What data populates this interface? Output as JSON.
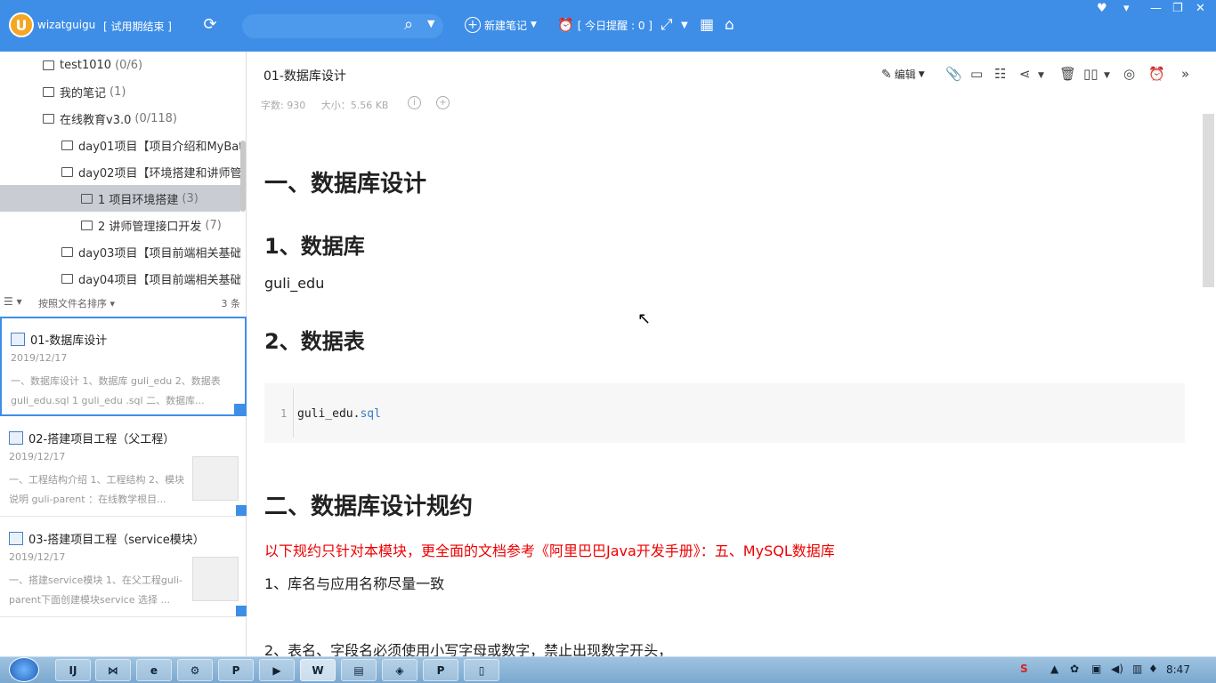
{
  "app": {
    "username": "wizatguigu",
    "trial": "[ 试用期结束 ]",
    "new_note": "新建笔记",
    "reminder": "[ 今日提醒 : 0 ]",
    "accent": "#3e8ee8"
  },
  "tree": [
    {
      "label": "test1010",
      "count": "(0/6)",
      "indent": 1
    },
    {
      "label": "我的笔记",
      "count": "(1)",
      "indent": 1
    },
    {
      "label": "在线教育v3.0",
      "count": "(0/118)",
      "indent": 1
    },
    {
      "label": "day01项目【项目介绍和MyBat",
      "count": "",
      "indent": 2
    },
    {
      "label": "day02项目【环境搭建和讲师管",
      "count": "",
      "indent": 2
    },
    {
      "label": "1 项目环境搭建",
      "count": "(3)",
      "indent": 3
    },
    {
      "label": "2 讲师管理接口开发",
      "count": "(7)",
      "indent": 3
    },
    {
      "label": "day03项目【项目前端相关基础",
      "count": "",
      "indent": 2
    },
    {
      "label": "day04项目【项目前端相关基础",
      "count": "",
      "indent": 2
    }
  ],
  "sortbar": {
    "label": "按照文件名排序",
    "count": "3 条"
  },
  "notes": [
    {
      "title": "01-数据库设计",
      "date": "2019/12/17",
      "snippet": "一、数据库设计 1、数据库 guli_edu 2、数据表 guli_edu.sql 1 guli_edu .sql 二、数据库..."
    },
    {
      "title": "02-搭建项目工程（父工程）",
      "date": "2019/12/17",
      "snippet": "一、工程结构介绍 1、工程结构 2、模块说明 guli-parent ：在线教学根目..."
    },
    {
      "title": "03-搭建项目工程（service模块）",
      "date": "2019/12/17",
      "snippet": "一、搭建service模块 1、在父工程guli-parent下面创建模块service 选择 ..."
    }
  ],
  "doc": {
    "title": "01-数据库设计",
    "words": "字数: 930",
    "size": "大小：5.56 KB",
    "edit": "编辑",
    "h1a": "一、数据库设计",
    "h2a": "1、数据库",
    "p1": "guli_edu",
    "h2b": "2、数据表",
    "code_line_no": "1",
    "code_name": "guli_edu.",
    "code_ext": "sql",
    "h1b": "二、数据库设计规约",
    "red_note": "以下规约只针对本模块，更全面的文档参考《阿里巴巴Java开发手册》：五、MySQL数据库",
    "rule1": "1、库名与应用名称尽量一致",
    "rule2": "2、表名、字段名必须使用小写字母或数字，禁止出现数字开头，"
  },
  "taskbar": {
    "clock": "8:47"
  }
}
